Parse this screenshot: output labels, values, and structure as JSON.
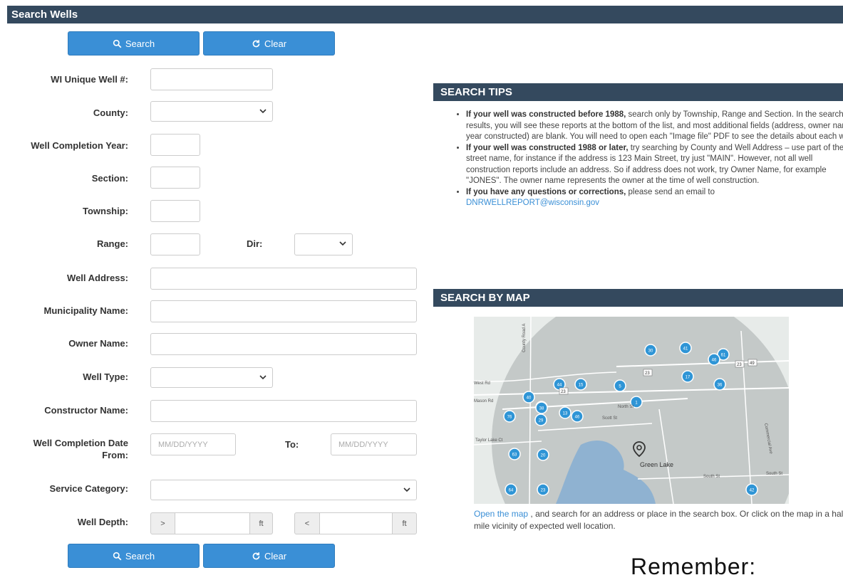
{
  "header": {
    "title": "Search Wells"
  },
  "buttons": {
    "search": "Search",
    "clear": "Clear"
  },
  "form": {
    "well_number_label": "WI Unique Well #:",
    "county_label": "County:",
    "completion_year_label": "Well Completion Year:",
    "section_label": "Section:",
    "township_label": "Township:",
    "range_label": "Range:",
    "dir_label": "Dir:",
    "address_label": "Well Address:",
    "municipality_label": "Municipality Name:",
    "owner_label": "Owner Name:",
    "well_type_label": "Well Type:",
    "constructor_label": "Constructor Name:",
    "date_from_label_1": "Well Completion Date",
    "date_from_label_2": "From:",
    "date_to_label": "To:",
    "date_placeholder": "MM/DD/YYYY",
    "service_label": "Service Category:",
    "depth_label": "Well Depth:",
    "depth_gt": ">",
    "depth_lt": "<",
    "depth_unit": "ft"
  },
  "tips": {
    "title": "SEARCH TIPS",
    "t1_bold": "If your well was constructed before 1988,",
    "t1_text": " search only by Township, Range and Section. In the search results, you will see these reports at the bottom of the list, and most additional fields (address, owner name, year constructed) are blank. You will need to open each \"Image file\" PDF to see the details about each well.",
    "t2_bold": "If your well was constructed 1988 or later,",
    "t2_text": " try searching by County and Well Address – use part of the street name, for instance if the address is 123 Main Street, try just \"MAIN\". However, not all well construction reports include an address. So if address does not work, try Owner Name, for example \"JONES\". The owner name represents the owner at the time of well construction.",
    "t3_bold": "If you have any questions or corrections,",
    "t3_text": " please send an email to",
    "email": "DNRWELLREPORT@wisconsin.gov"
  },
  "map_section": {
    "title": "SEARCH BY MAP",
    "town_label": "Green Lake",
    "streets": {
      "north": "North St",
      "scott": "Scott St",
      "south1": "South St",
      "south2": "South St",
      "taylor": "Taylor Lake Ct",
      "county": "County Road A",
      "commercial": "Commercial Ave",
      "west": "West Rd",
      "mason": "Mason Rd"
    },
    "route_23": "23",
    "route_49": "49",
    "clusters": [
      "30",
      "41",
      "61",
      "46",
      "17",
      "36",
      "44",
      "15",
      "5",
      "1",
      "40",
      "23",
      "76",
      "38",
      "13",
      "29",
      "46",
      "63",
      "20",
      "64",
      "23",
      "42"
    ],
    "link_text": "Open the map",
    "caption": " , and search for an address or place in the search box. Or click on the map in a half mile vicinity of expected well location."
  },
  "footer": {
    "overlay_text": "Remember:"
  }
}
